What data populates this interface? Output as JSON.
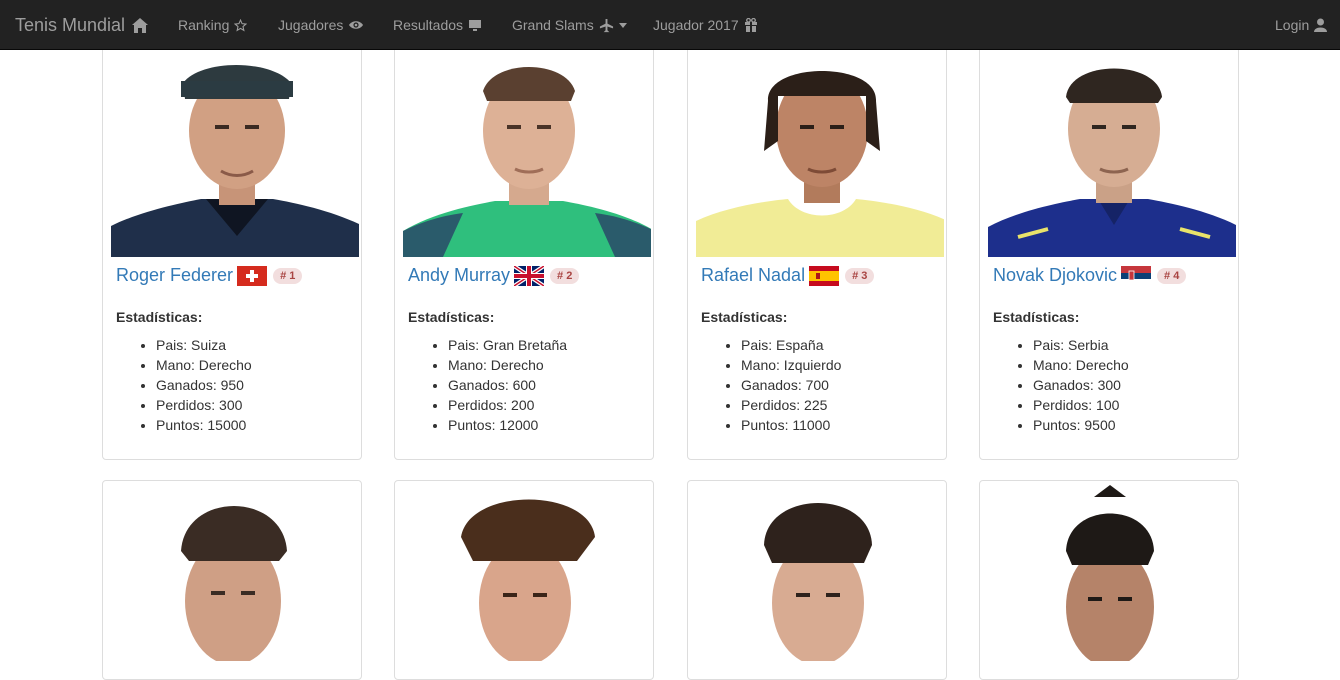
{
  "navbar": {
    "brand": "Tenis Mundial",
    "items": [
      {
        "label": "Ranking",
        "icon": "star-icon"
      },
      {
        "label": "Jugadores",
        "icon": "eye-icon"
      },
      {
        "label": "Resultados",
        "icon": "monitor-icon"
      },
      {
        "label": "Grand Slams",
        "icon": "plane-icon"
      },
      {
        "label": "Jugador 2017",
        "icon": "gift-icon"
      }
    ],
    "login": "Login"
  },
  "stats_title": "Estadísticas:",
  "players": [
    {
      "name": "Roger Federer",
      "rank": "# 1",
      "stats": [
        "Pais: Suiza",
        "Mano: Derecho",
        "Ganados: 950",
        "Perdidos: 300",
        "Puntos: 15000"
      ]
    },
    {
      "name": "Andy Murray",
      "rank": "# 2",
      "stats": [
        "Pais: Gran Bretaña",
        "Mano: Derecho",
        "Ganados: 600",
        "Perdidos: 200",
        "Puntos: 12000"
      ]
    },
    {
      "name": "Rafael Nadal",
      "rank": "# 3",
      "stats": [
        "Pais: España",
        "Mano: Izquierdo",
        "Ganados: 700",
        "Perdidos: 225",
        "Puntos: 11000"
      ]
    },
    {
      "name": "Novak Djokovic",
      "rank": "# 4",
      "stats": [
        "Pais: Serbia",
        "Mano: Derecho",
        "Ganados: 300",
        "Perdidos: 100",
        "Puntos: 9500"
      ]
    }
  ],
  "colors": {
    "navbar_bg": "#222222",
    "nav_text": "#9d9d9d",
    "link": "#337ab7",
    "badge_bg": "#f2dede",
    "badge_text": "#a94442"
  }
}
